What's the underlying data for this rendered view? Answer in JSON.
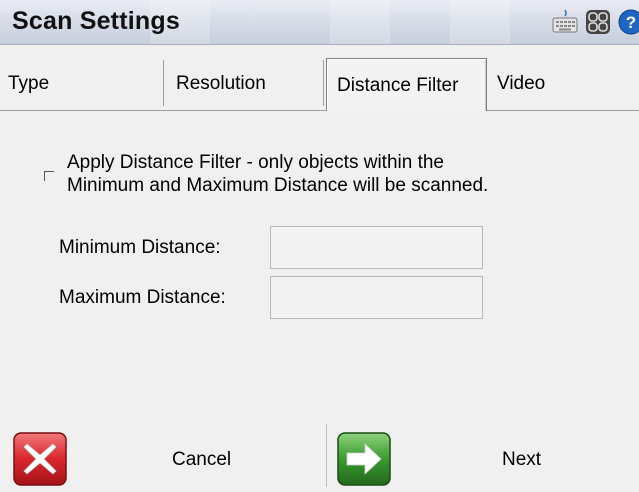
{
  "window": {
    "title": "Scan Settings",
    "icons": [
      "keyboard-icon",
      "grid-icon",
      "help-icon"
    ],
    "help_glyph": "?"
  },
  "tabs": [
    {
      "label": "Type",
      "selected": false
    },
    {
      "label": "Resolution",
      "selected": false
    },
    {
      "label": "Distance Filter",
      "selected": true
    },
    {
      "label": "Video",
      "selected": false
    }
  ],
  "distance_filter": {
    "checkbox": {
      "checked": false,
      "label_line1": "Apply Distance Filter - only objects within the",
      "label_line2": "Minimum and Maximum Distance will be scanned."
    },
    "minimum": {
      "label": "Minimum Distance:",
      "value": ""
    },
    "maximum": {
      "label": "Maximum Distance:",
      "value": ""
    }
  },
  "footer": {
    "cancel_label": "Cancel",
    "next_label": "Next",
    "cancel_icon": "red-x-icon",
    "next_icon": "green-arrow-right-icon"
  },
  "colors": {
    "cancel_red": "#d9262c",
    "next_green": "#3a9a2e",
    "help_blue": "#1f66c1"
  }
}
